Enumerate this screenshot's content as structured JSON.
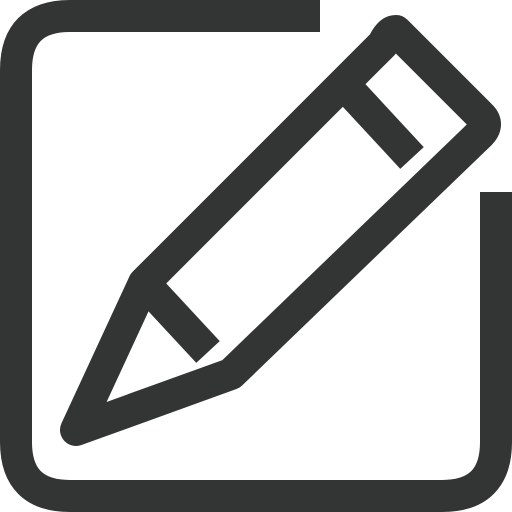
{
  "icon": {
    "name": "edit-icon",
    "components": [
      "square-frame",
      "pencil"
    ],
    "colors": {
      "stroke": "#333535",
      "background": "#ffffff"
    }
  }
}
